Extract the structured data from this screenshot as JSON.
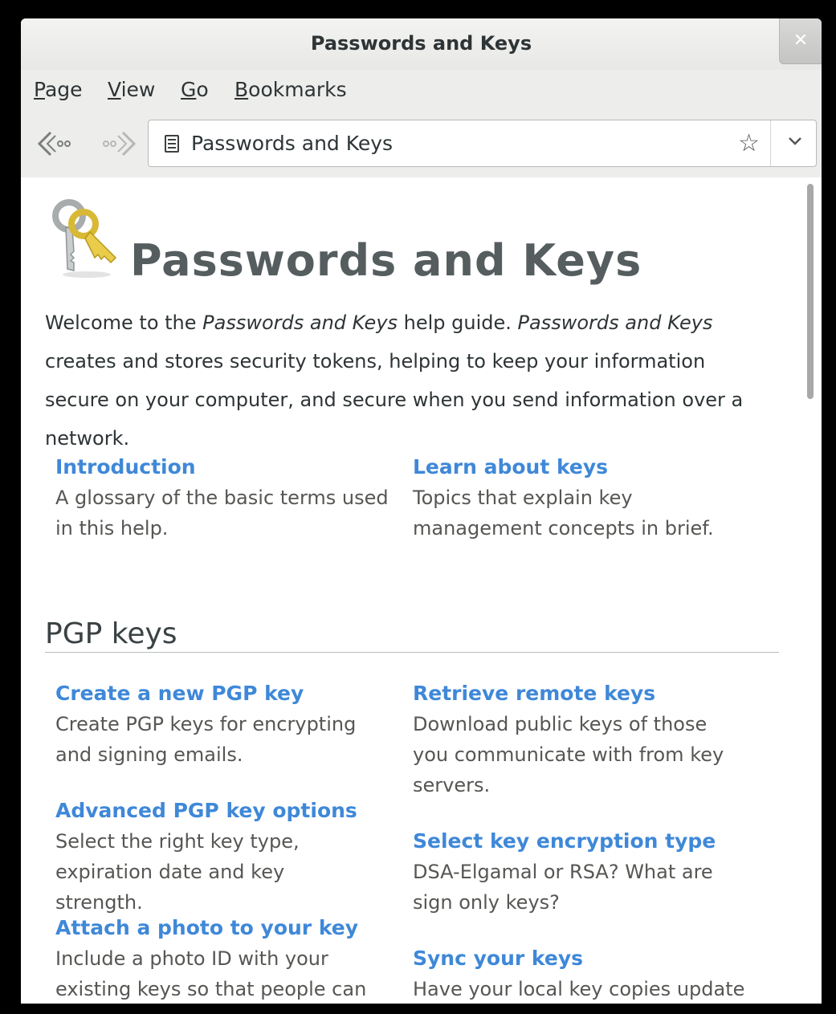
{
  "window": {
    "title": "Passwords and Keys",
    "close_glyph": "✕"
  },
  "menubar": {
    "items": [
      {
        "first": "P",
        "rest": "age"
      },
      {
        "first": "V",
        "rest": "iew"
      },
      {
        "first": "G",
        "rest": "o"
      },
      {
        "first": "B",
        "rest": "ookmarks"
      }
    ]
  },
  "toolbar": {
    "location_text": "Passwords and Keys",
    "back_icon": "back-arrow-icon",
    "forward_icon": "forward-arrow-icon",
    "bookmark_icon": "star-icon",
    "dropdown_icon": "chevron-down-icon"
  },
  "page": {
    "title": "Passwords and Keys",
    "intro": {
      "p1": "Welcome to the ",
      "em1": "Passwords and Keys",
      "p2": " help guide. ",
      "em2": "Passwords and Keys",
      "p3": " creates and stores security tokens, helping to keep your information secure on your computer, and secure when you send information over a network."
    },
    "top_links": [
      {
        "title": "Introduction",
        "desc": "A glossary of the basic terms used in this help."
      },
      {
        "title": "Learn about keys",
        "desc": "Topics that explain key management concepts in brief."
      }
    ],
    "pgp_section": {
      "heading": "PGP keys",
      "left": [
        {
          "title": "Create a new PGP key",
          "desc": "Create PGP keys for encrypting and signing emails."
        },
        {
          "title": "Advanced PGP key options",
          "desc": "Select the right key type, expiration date and key strength."
        },
        {
          "title": "Attach a photo to your key",
          "desc": "Include a photo ID with your existing keys so that people can"
        }
      ],
      "right": [
        {
          "title": "Retrieve remote keys",
          "desc": "Download public keys of those you communicate with from key servers."
        },
        {
          "title": "Select key encryption type",
          "desc": "DSA-Elgamal or RSA? What are sign only keys?"
        },
        {
          "title": "Sync your keys",
          "desc": "Have your local key copies update"
        }
      ]
    }
  }
}
